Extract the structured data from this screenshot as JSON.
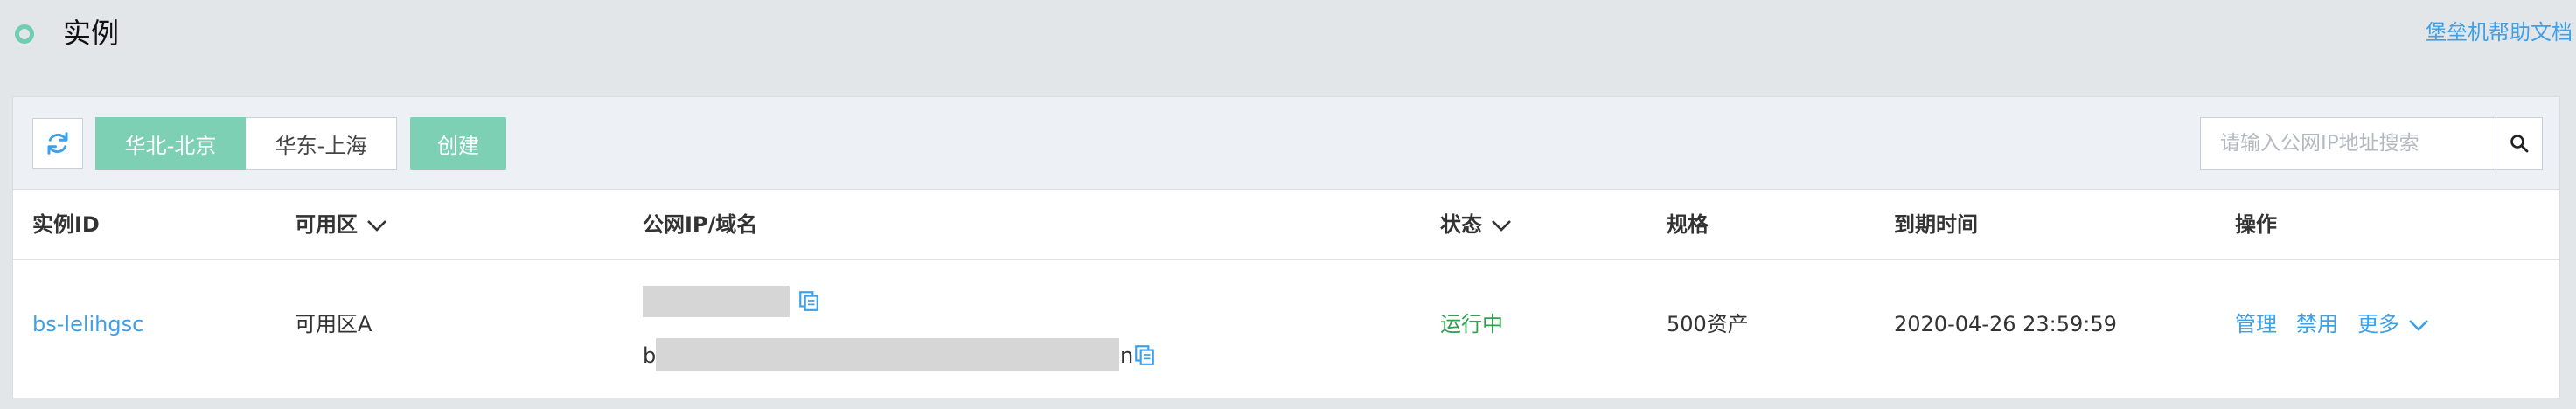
{
  "header": {
    "title": "实例",
    "help_link": "堡垒机帮助文档"
  },
  "toolbar": {
    "regions": [
      {
        "label": "华北-北京",
        "active": true
      },
      {
        "label": "华东-上海",
        "active": false
      }
    ],
    "create_label": "创建",
    "search": {
      "placeholder": "请输入公网IP地址搜索",
      "value": ""
    }
  },
  "table": {
    "columns": {
      "instance_id": "实例ID",
      "zone": "可用区",
      "ip": "公网IP/域名",
      "status": "状态",
      "spec": "规格",
      "expiry": "到期时间",
      "actions": "操作"
    },
    "rows": [
      {
        "instance_id": "bs-lelihgsc",
        "zone": "可用区A",
        "ip_prefix_char": "b",
        "ip_suffix_char": "n",
        "status": "运行中",
        "spec": "500资产",
        "expiry": "2020-04-26 23:59:59",
        "actions": {
          "manage": "管理",
          "disable": "禁用",
          "more": "更多"
        }
      }
    ]
  },
  "colors": {
    "accent": "#7dd0b3",
    "link": "#3ea0e8",
    "running": "#2ea44f",
    "background": "#e3e6e9"
  }
}
